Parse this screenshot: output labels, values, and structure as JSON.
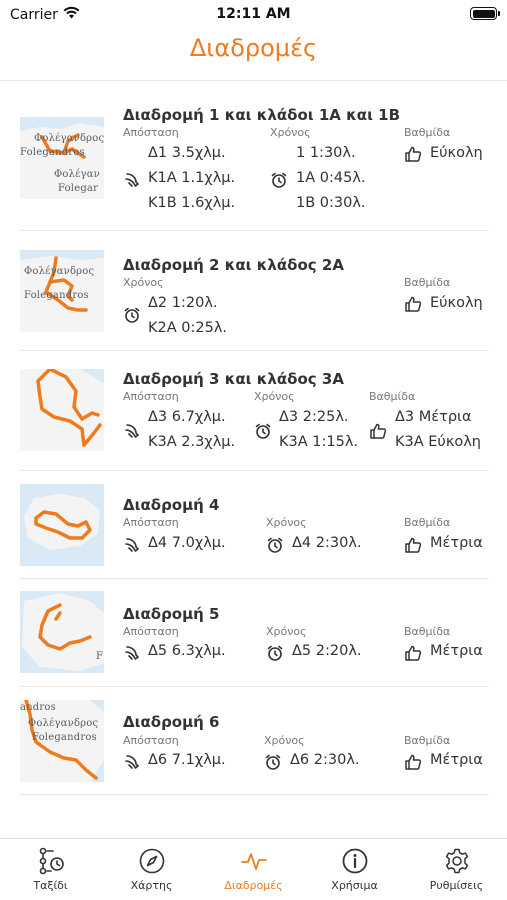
{
  "status_bar": {
    "carrier": "Carrier",
    "time": "12:11 AM"
  },
  "header": {
    "title": "Διαδρομές"
  },
  "colors": {
    "accent": "#f07b1d",
    "map_sea": "#d9e9f5",
    "map_land": "#f4f4f4",
    "route_line": "#f07b1d"
  },
  "routes": [
    {
      "title": "Διαδρομή 1 και κλάδοι 1Α και 1Β",
      "map_labels": [
        "Φολέγανδρος",
        "Folegandros",
        "Φολέγαν",
        "Folegar"
      ],
      "distance": {
        "label": "Απόσταση",
        "values": [
          "Δ1 3.5χλμ.",
          "Κ1Α 1.1χλμ.",
          "Κ1Β 1.6χλμ."
        ]
      },
      "time": {
        "label": "Χρόνος",
        "values": [
          "1 1:30λ.",
          "1Α 0:45λ.",
          "1Β 0:30λ."
        ]
      },
      "difficulty": {
        "label": "Βαθμίδα",
        "values": [
          "Εύκολη"
        ]
      }
    },
    {
      "title": "Διαδρομή 2 και κλάδος 2Α",
      "map_labels": [
        "Φολέγανδρος",
        "Folegandros"
      ],
      "time": {
        "label": "Χρόνος",
        "values": [
          "Δ2 1:20λ.",
          "Κ2Α 0:25λ."
        ]
      },
      "difficulty": {
        "label": "Βαθμίδα",
        "values": [
          "Εύκολη"
        ]
      }
    },
    {
      "title": "Διαδρομή 3 και κλάδος 3Α",
      "distance": {
        "label": "Απόσταση",
        "values": [
          "Δ3 6.7χλμ.",
          "Κ3Α 2.3χλμ."
        ]
      },
      "time": {
        "label": "Χρόνος",
        "values": [
          "Δ3 2:25λ.",
          "Κ3Α 1:15λ."
        ]
      },
      "difficulty": {
        "label": "Βαθμίδα",
        "values": [
          "Δ3 Μέτρια",
          "Κ3Α Εύκολη"
        ]
      }
    },
    {
      "title": "Διαδρομή 4",
      "distance": {
        "label": "Απόσταση",
        "values": [
          "Δ4 7.0χλμ."
        ]
      },
      "time": {
        "label": "Χρόνος",
        "values": [
          "Δ4 2:30λ."
        ]
      },
      "difficulty": {
        "label": "Βαθμίδα",
        "values": [
          "Μέτρια"
        ]
      }
    },
    {
      "title": "Διαδρομή 5",
      "map_labels": [
        "F"
      ],
      "distance": {
        "label": "Απόσταση",
        "values": [
          "Δ5 6.3χλμ."
        ]
      },
      "time": {
        "label": "Χρόνος",
        "values": [
          "Δ5 2:20λ."
        ]
      },
      "difficulty": {
        "label": "Βαθμίδα",
        "values": [
          "Μέτρια"
        ]
      }
    },
    {
      "title": "Διαδρομή 6",
      "map_labels": [
        "andros",
        "Φολέγανδρος",
        "Folegandros"
      ],
      "distance": {
        "label": "Απόσταση",
        "values": [
          "Δ6 7.1χλμ."
        ]
      },
      "time": {
        "label": "Χρόνος",
        "values": [
          "Δ6 2:30λ."
        ]
      },
      "difficulty": {
        "label": "Βαθμίδα",
        "values": [
          "Μέτρια"
        ]
      }
    }
  ],
  "tab_bar": {
    "active_tab": "Διαδρομές",
    "tabs": [
      {
        "label": "Ταξίδι",
        "icon": "itinerary-icon"
      },
      {
        "label": "Χάρτης",
        "icon": "compass-icon"
      },
      {
        "label": "Διαδρομές",
        "icon": "pulse-route-icon"
      },
      {
        "label": "Χρήσιμα",
        "icon": "info-icon"
      },
      {
        "label": "Ρυθμίσεις",
        "icon": "gear-icon"
      }
    ]
  }
}
